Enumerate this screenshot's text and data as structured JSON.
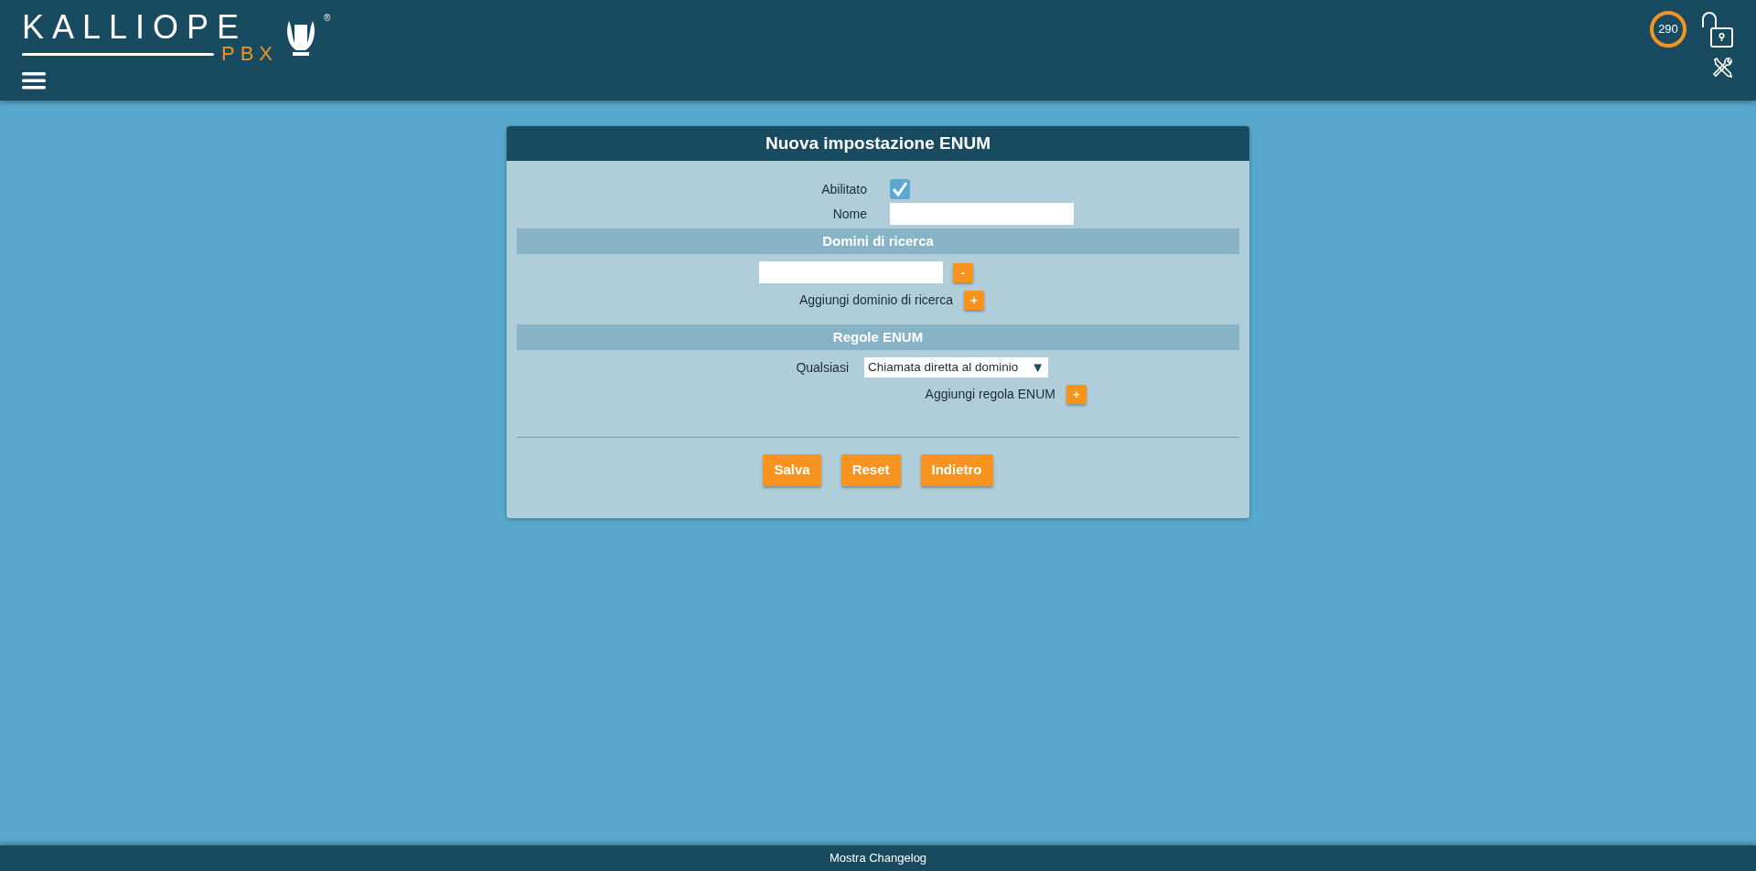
{
  "header": {
    "logo": {
      "name": "KALLIOPE",
      "product": "PBX",
      "mark": "®"
    },
    "counter": "290"
  },
  "form": {
    "title": "Nuova impostazione ENUM",
    "enabled": {
      "label": "Abilitato",
      "checked": true
    },
    "name": {
      "label": "Nome"
    },
    "sections": [
      {
        "title": "Domini di ricerca",
        "domains": [
          {
            "remove": "-"
          }
        ],
        "add": {
          "label": "Aggiungi dominio di ricerca",
          "button": "+"
        }
      },
      {
        "title": "Regole ENUM",
        "rules": [
          {
            "label": "Qualsiasi",
            "value": "Chiamata diretta al dominio",
            "caret": "▼"
          }
        ],
        "add": {
          "label": "Aggiungi regola ENUM",
          "button": "+"
        }
      }
    ],
    "buttons": [
      "Salva",
      "Reset",
      "Indietro"
    ]
  },
  "footer": {
    "link": "Mostra Changelog"
  }
}
